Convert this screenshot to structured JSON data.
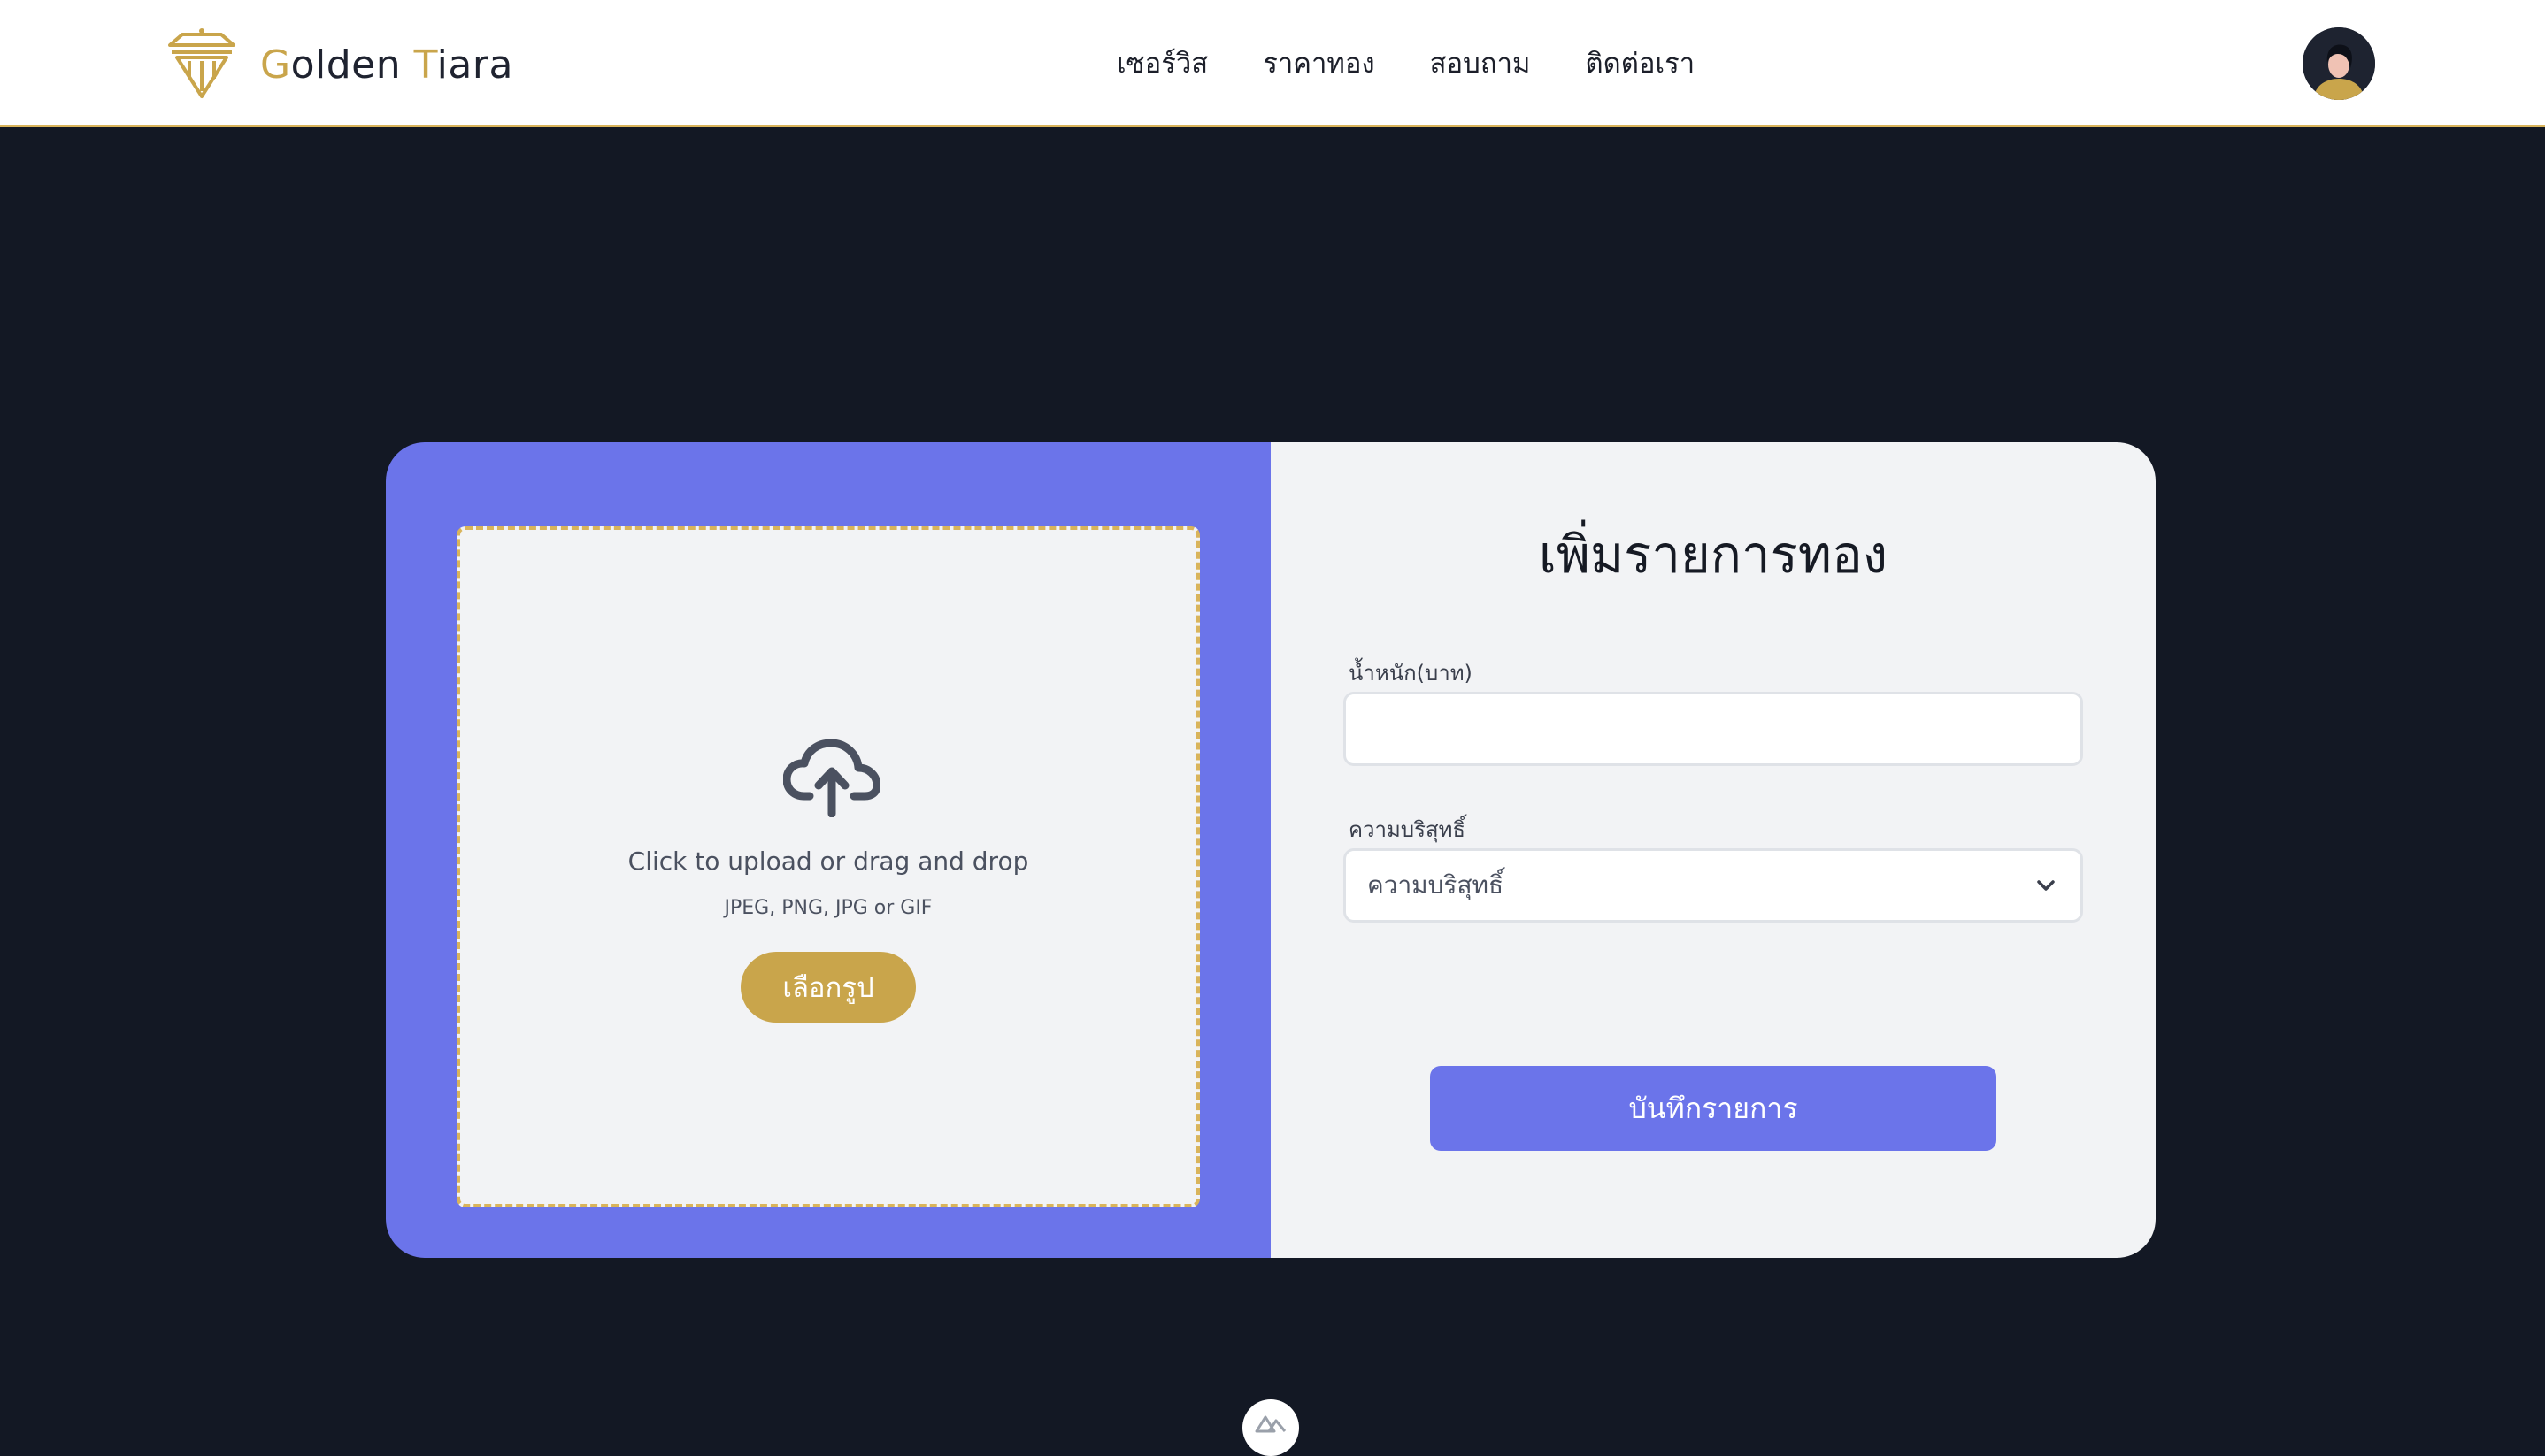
{
  "brand": {
    "name_initial_1": "G",
    "name_rest_1": "olden ",
    "name_initial_2": "T",
    "name_rest_2": "iara",
    "logo_icon": "pillar-crown-icon"
  },
  "nav": {
    "items": [
      {
        "label": "เซอร์วิส"
      },
      {
        "label": "ราคาทอง"
      },
      {
        "label": "สอบถาม"
      },
      {
        "label": "ติดต่อเรา"
      }
    ]
  },
  "upload": {
    "icon": "cloud-upload-icon",
    "instruction": "Click to upload or drag and drop",
    "formats": "JPEG, PNG, JPG or GIF",
    "choose_label": "เลือกรูป"
  },
  "form": {
    "title": "เพิ่มรายการทอง",
    "weight_label": "น้ำหนัก(บาท)",
    "weight_value": "",
    "purity_label": "ความบริสุทธิ์",
    "purity_selected": "ความบริสุทธิ์",
    "save_label": "บันทึกรายการ"
  },
  "colors": {
    "accent_gold": "#c9a54b",
    "primary_indigo": "#6b74ea",
    "page_background": "#131824",
    "card_right_background": "#f2f3f5"
  }
}
